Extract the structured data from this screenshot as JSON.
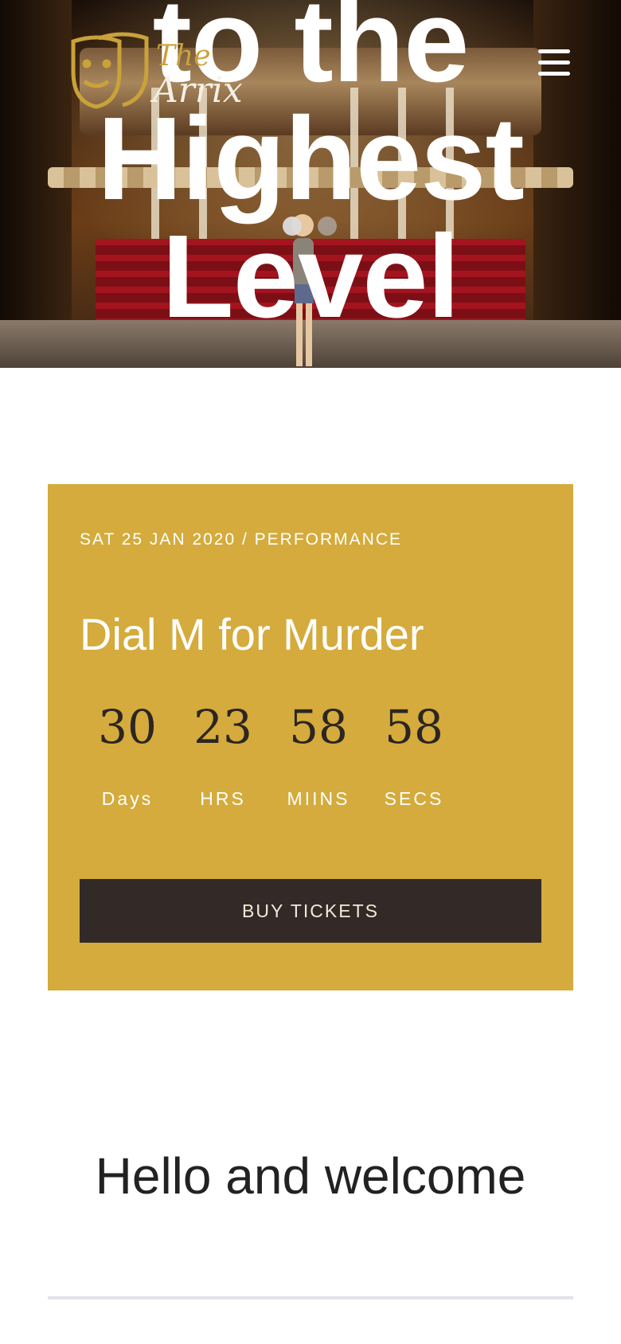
{
  "hero": {
    "title_lines": [
      "to the",
      "Highest",
      "Level"
    ],
    "logo": {
      "word_top": "The",
      "word_bottom": "Arrix",
      "color": "#c9a23a"
    },
    "menu_icon": "hamburger-icon",
    "slider": {
      "count": 2,
      "active_index": 0
    }
  },
  "event": {
    "meta": "SAT 25 JAN 2020 / PERFORMANCE",
    "title": "Dial M for Murder",
    "countdown": [
      {
        "value": "30",
        "label": "Days"
      },
      {
        "value": "23",
        "label": "HRS"
      },
      {
        "value": "58",
        "label": "MIINS"
      },
      {
        "value": "58",
        "label": "SECS"
      }
    ],
    "button_label": "BUY TICKETS",
    "card_color": "#d4ab3c",
    "button_color": "#332a28"
  },
  "welcome": {
    "title": "Hello and welcome"
  }
}
